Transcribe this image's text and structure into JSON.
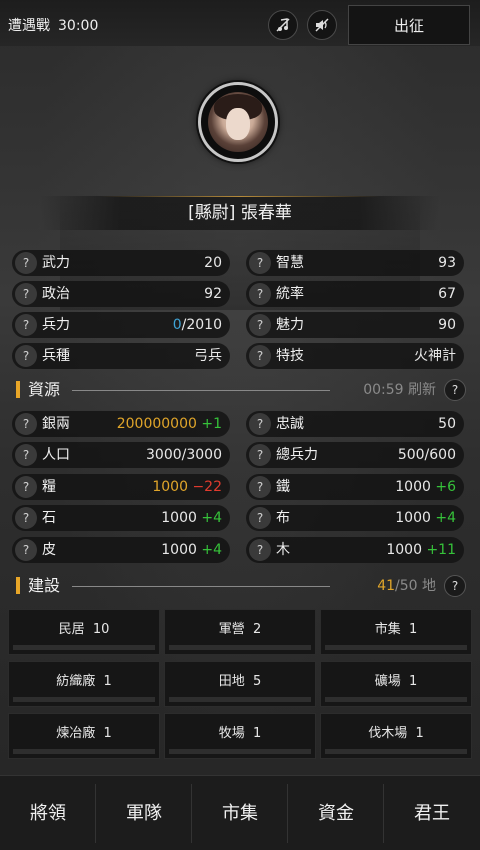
{
  "topbar": {
    "mode": "遭遇戰",
    "timer": "30:00",
    "music_icon": "music-muted-icon",
    "sound_icon": "sound-muted-icon",
    "sortie_label": "出征"
  },
  "character": {
    "nameplate": "[縣尉] 張春華"
  },
  "stats": [
    {
      "label": "武力",
      "value": "20"
    },
    {
      "label": "智慧",
      "value": "93"
    },
    {
      "label": "政治",
      "value": "92"
    },
    {
      "label": "統率",
      "value": "67"
    },
    {
      "label": "兵力",
      "value_a": "0",
      "value_b": "/2010"
    },
    {
      "label": "魅力",
      "value": "90"
    },
    {
      "label": "兵種",
      "value": "弓兵"
    },
    {
      "label": "特技",
      "value": "火神計"
    }
  ],
  "resources": {
    "title": "資源",
    "refresh_time": "00:59",
    "refresh_label": "刷新",
    "items": [
      {
        "label": "銀兩",
        "value": "200000000",
        "delta": "+1",
        "value_color": "#e0a52a",
        "delta_color": "#36c23a"
      },
      {
        "label": "忠誠",
        "value": "50",
        "value_color": "#e0a52a"
      },
      {
        "label": "人口",
        "value": "3000/3000"
      },
      {
        "label": "總兵力",
        "value": "500/600"
      },
      {
        "label": "糧",
        "value": "1000",
        "delta": "−22",
        "value_color": "#e0a52a",
        "delta_color": "#e23b2e"
      },
      {
        "label": "鐵",
        "value": "1000",
        "delta": "+6",
        "delta_color": "#36c23a"
      },
      {
        "label": "石",
        "value": "1000",
        "delta": "+4",
        "delta_color": "#36c23a"
      },
      {
        "label": "布",
        "value": "1000",
        "delta": "+4",
        "delta_color": "#36c23a"
      },
      {
        "label": "皮",
        "value": "1000",
        "delta": "+4",
        "delta_color": "#36c23a"
      },
      {
        "label": "木",
        "value": "1000",
        "delta": "+11",
        "delta_color": "#36c23a"
      }
    ]
  },
  "construction": {
    "title": "建設",
    "land_used": "41",
    "land_total": "/50",
    "land_label": "地",
    "buildings": [
      {
        "name": "民居",
        "level": "10"
      },
      {
        "name": "軍營",
        "level": "2"
      },
      {
        "name": "市集",
        "level": "1"
      },
      {
        "name": "紡織廠",
        "level": "1"
      },
      {
        "name": "田地",
        "level": "5"
      },
      {
        "name": "礦場",
        "level": "1"
      },
      {
        "name": "煉冶廠",
        "level": "1"
      },
      {
        "name": "牧場",
        "level": "1"
      },
      {
        "name": "伐木場",
        "level": "1"
      }
    ]
  },
  "nav": [
    "將領",
    "軍隊",
    "市集",
    "資金",
    "君王"
  ],
  "question_mark": "?"
}
